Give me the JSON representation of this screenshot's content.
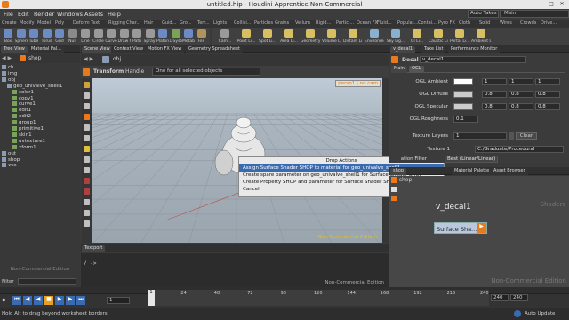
{
  "window": {
    "title": "untitled.hip - Houdini Apprentice Non-Commercial"
  },
  "menu": {
    "items": [
      "File",
      "Edit",
      "Render",
      "Windows",
      "Assets",
      "Help"
    ],
    "auto_takes": "Auto Takes",
    "desktop": "Main"
  },
  "shelf_tabs_left": [
    "Create",
    "Modify",
    "Model",
    "Poly",
    "Deform",
    "Text",
    "Rigging",
    "Char...",
    "Hair",
    "Guid...",
    "Gro...",
    "Terr..."
  ],
  "shelf_tabs_right": [
    "Lights",
    "Collisi...",
    "Particles",
    "Grains",
    "Vellum",
    "Rigid...",
    "Particl...",
    "Ocean FX",
    "Fluid...",
    "Populat...",
    "Contai...",
    "Pyro FX",
    "Cloth",
    "Solid",
    "Wires",
    "Crowds",
    "Drive..."
  ],
  "shelf_tools_left": [
    {
      "label": "Box",
      "color": "#6a8bc4"
    },
    {
      "label": "Sphere",
      "color": "#6a8bc4"
    },
    {
      "label": "Tube",
      "color": "#6a8bc4"
    },
    {
      "label": "Torus",
      "color": "#6a8bc4"
    },
    {
      "label": "Grid",
      "color": "#6a8bc4"
    },
    {
      "label": "Null",
      "color": "#8a8a8a"
    },
    {
      "label": "Line",
      "color": "#9a9a9a"
    },
    {
      "label": "Circle",
      "color": "#9a9a9a"
    },
    {
      "label": "Curve",
      "color": "#9a9a9a"
    },
    {
      "label": "Draw Cur...",
      "color": "#9a9a9a"
    },
    {
      "label": "Path",
      "color": "#9a9a9a"
    },
    {
      "label": "Spray Paint",
      "color": "#9a9a9a"
    },
    {
      "label": "Platonic Sol...",
      "color": "#6a8bc4"
    },
    {
      "label": "L-System",
      "color": "#7aa35a"
    },
    {
      "label": "Metaball",
      "color": "#6a8bc4"
    },
    {
      "label": "File",
      "color": "#b0945a"
    }
  ],
  "shelf_tools_right": [
    {
      "label": "Cam...",
      "color": "#9a9a9a"
    },
    {
      "label": "Point Li...",
      "color": "#d8c060"
    },
    {
      "label": "Spot Li...",
      "color": "#d8c060"
    },
    {
      "label": "Area Li...",
      "color": "#d8c060"
    },
    {
      "label": "Geometry L...",
      "color": "#d8c060"
    },
    {
      "label": "Volume Li...",
      "color": "#d8c060"
    },
    {
      "label": "Distant Li...",
      "color": "#d8c060"
    },
    {
      "label": "Environme...",
      "color": "#8ab0d0"
    },
    {
      "label": "Sky Lig...",
      "color": "#8ab0d0"
    },
    {
      "label": "GI Li...",
      "color": "#d8c060"
    },
    {
      "label": "Caustic Li...",
      "color": "#d8c060"
    },
    {
      "label": "Portal Li...",
      "color": "#d8c060"
    },
    {
      "label": "Ambient L...",
      "color": "#d8c060"
    }
  ],
  "tree_panel": {
    "tabs": [
      "Tree View",
      "Material Pal...",
      "Asset Browser"
    ],
    "path": "shop",
    "rows": [
      {
        "label": "ch",
        "depth": 0
      },
      {
        "label": "img",
        "depth": 0
      },
      {
        "label": "obj",
        "depth": 0
      },
      {
        "label": "geo_univalve_shell1",
        "depth": 1
      },
      {
        "label": "color1",
        "depth": 2
      },
      {
        "label": "copy1",
        "depth": 2
      },
      {
        "label": "curve1",
        "depth": 2
      },
      {
        "label": "edit1",
        "depth": 2
      },
      {
        "label": "edit2",
        "depth": 2
      },
      {
        "label": "group1",
        "depth": 2
      },
      {
        "label": "primitive1",
        "depth": 2
      },
      {
        "label": "skin1",
        "depth": 2
      },
      {
        "label": "uvtexture1",
        "depth": 2
      },
      {
        "label": "xform1",
        "depth": 2
      },
      {
        "label": "out",
        "depth": 0
      },
      {
        "label": "shop",
        "depth": 0
      },
      {
        "label": "vex",
        "depth": 0
      }
    ],
    "watermark": "Non-Commercial Edition",
    "filter_label": "Filter"
  },
  "viewer": {
    "tabs": [
      "Scene View",
      "Context View",
      "Motion FX View",
      "Geometry Spreadsheet"
    ],
    "path": "obj",
    "tool_name": "Transform",
    "handle_label": "Handle",
    "select_mode": "One for all selected objects",
    "camera_menu": "persp1 | no cam",
    "watermark": "Non-Commercial Edition"
  },
  "context_menu": {
    "header": "Drop Actions",
    "items": [
      "Assign Surface Shader SHOP to material for geo_univalve_shell1",
      "Create spare parameter on geo_univalve_shell1 for Surface Shader SHOP",
      "Create Property SHOP and parameter for Surface Shader SHOP",
      "Cancel"
    ],
    "selected_index": 0
  },
  "textport": {
    "tab": "Textport",
    "prompt": "/ ->",
    "watermark": "Non-Commercial Edition"
  },
  "params": {
    "tabs": [
      "v_decal1",
      "Take List",
      "Performance Monitor"
    ],
    "node_type": "Decal",
    "node_name": "v_decal1",
    "subtabs": [
      "Main",
      "OGL"
    ],
    "rows": [
      {
        "label": "OGL Ambient",
        "swatch": "#ffffff",
        "v1": "1",
        "v2": "1",
        "v3": "1"
      },
      {
        "label": "OGL Diffuse",
        "swatch": "#cccccc",
        "v1": "0.8",
        "v2": "0.8",
        "v3": "0.8"
      },
      {
        "label": "OGL Specular",
        "swatch": "#cccccc",
        "v1": "0.8",
        "v2": "0.8",
        "v3": "0.8"
      },
      {
        "label": "OGL Roughness",
        "swatch": "",
        "v1": "0.1",
        "v2": "",
        "v3": ""
      }
    ],
    "texture_layers_label": "Texture Layers",
    "texture_layers_value": "1",
    "clear_button": "Clear",
    "texture_label": "Texture 1",
    "texture_value": "C:/Graduate/Procedural",
    "filter_label": "ation Filter",
    "filter_value": "Best (Linear/Linear)"
  },
  "network": {
    "tabs": [
      "shop",
      "Material Palette",
      "Asset Browser"
    ],
    "path": "shop",
    "context_label": "Shaders",
    "node_name": "v_decal1",
    "node_label": "Surface Sha...",
    "watermark": "Non-Commercial Edition"
  },
  "timeline": {
    "frame_ticks": [
      "1",
      "24",
      "48",
      "72",
      "96",
      "120",
      "144",
      "168",
      "192",
      "216",
      "240"
    ],
    "current_frame": "1",
    "start_frame": "1",
    "end_frame": "240",
    "end_frame2": "240"
  },
  "status": {
    "message": "Hold Alt to drag beyond worksheet borders",
    "auto_update": "Auto Update"
  },
  "colors": {
    "accent_orange": "#e87a1e",
    "selection_blue": "#3a6bb0",
    "node_blue": "#b9c8dc"
  }
}
